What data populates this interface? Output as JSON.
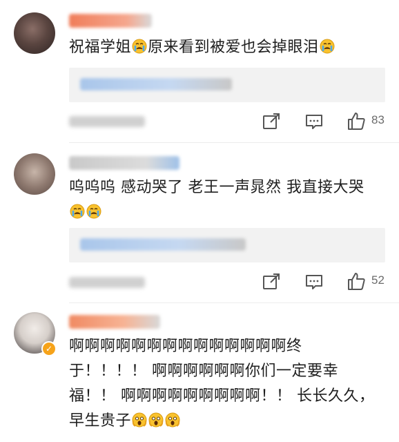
{
  "comments": [
    {
      "text_parts": [
        "祝福学姐",
        "😭",
        "原来看到被爱也会掉眼泪",
        "😭"
      ],
      "likes": "83"
    },
    {
      "line1": "呜呜呜 感动哭了 老王一声晁然 我直接大哭",
      "line2_emoji": [
        "😭",
        "😭"
      ],
      "likes": "52"
    },
    {
      "line1": "啊啊啊啊啊啊啊啊啊啊啊啊啊啊终",
      "line2": "于！！！！ 啊啊啊啊啊啊你们一定要幸",
      "line3": "福！！ 啊啊啊啊啊啊啊啊啊！！ 长长久久，",
      "line4": "早生贵子",
      "line4_emoji": [
        "😱",
        "😱",
        "😱"
      ]
    }
  ],
  "badge": {
    "verified_symbol": "✓",
    "color": "#f6a31a"
  },
  "icons": [
    "share-icon",
    "comment-icon",
    "like-icon"
  ]
}
